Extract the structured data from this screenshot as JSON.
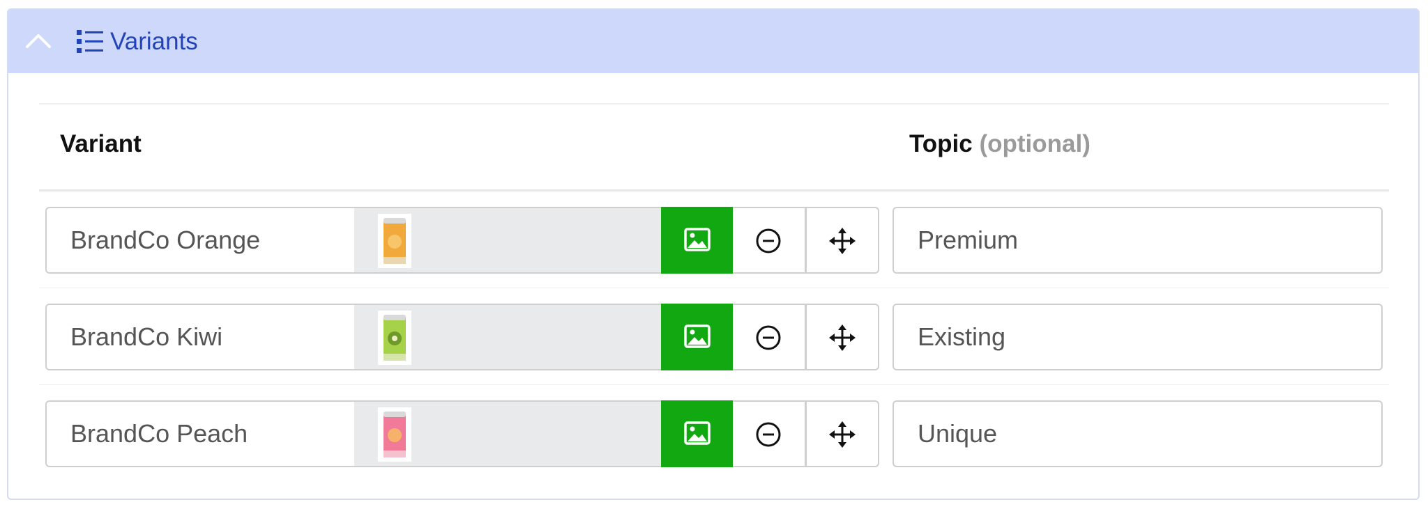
{
  "panel": {
    "title": "Variants",
    "collapse_icon": "chevron-up-icon",
    "title_icon": "list-icon",
    "header_color": "#cdd8fb",
    "title_color": "#2344b8"
  },
  "columns": {
    "variant_label": "Variant",
    "topic_label": "Topic",
    "topic_hint": "(optional)"
  },
  "rows": [
    {
      "name": "BrandCo Orange",
      "topic": "Premium",
      "thumb_color": "#f2a93b"
    },
    {
      "name": "BrandCo Kiwi",
      "topic": "Existing",
      "thumb_color": "#a6d24a"
    },
    {
      "name": "BrandCo Peach",
      "topic": "Unique",
      "thumb_color": "#f07a98"
    }
  ],
  "buttons": {
    "image_icon": "image-icon",
    "remove_icon": "minus-circle-icon",
    "move_icon": "move-arrows-icon",
    "image_button_color": "#12a812"
  }
}
